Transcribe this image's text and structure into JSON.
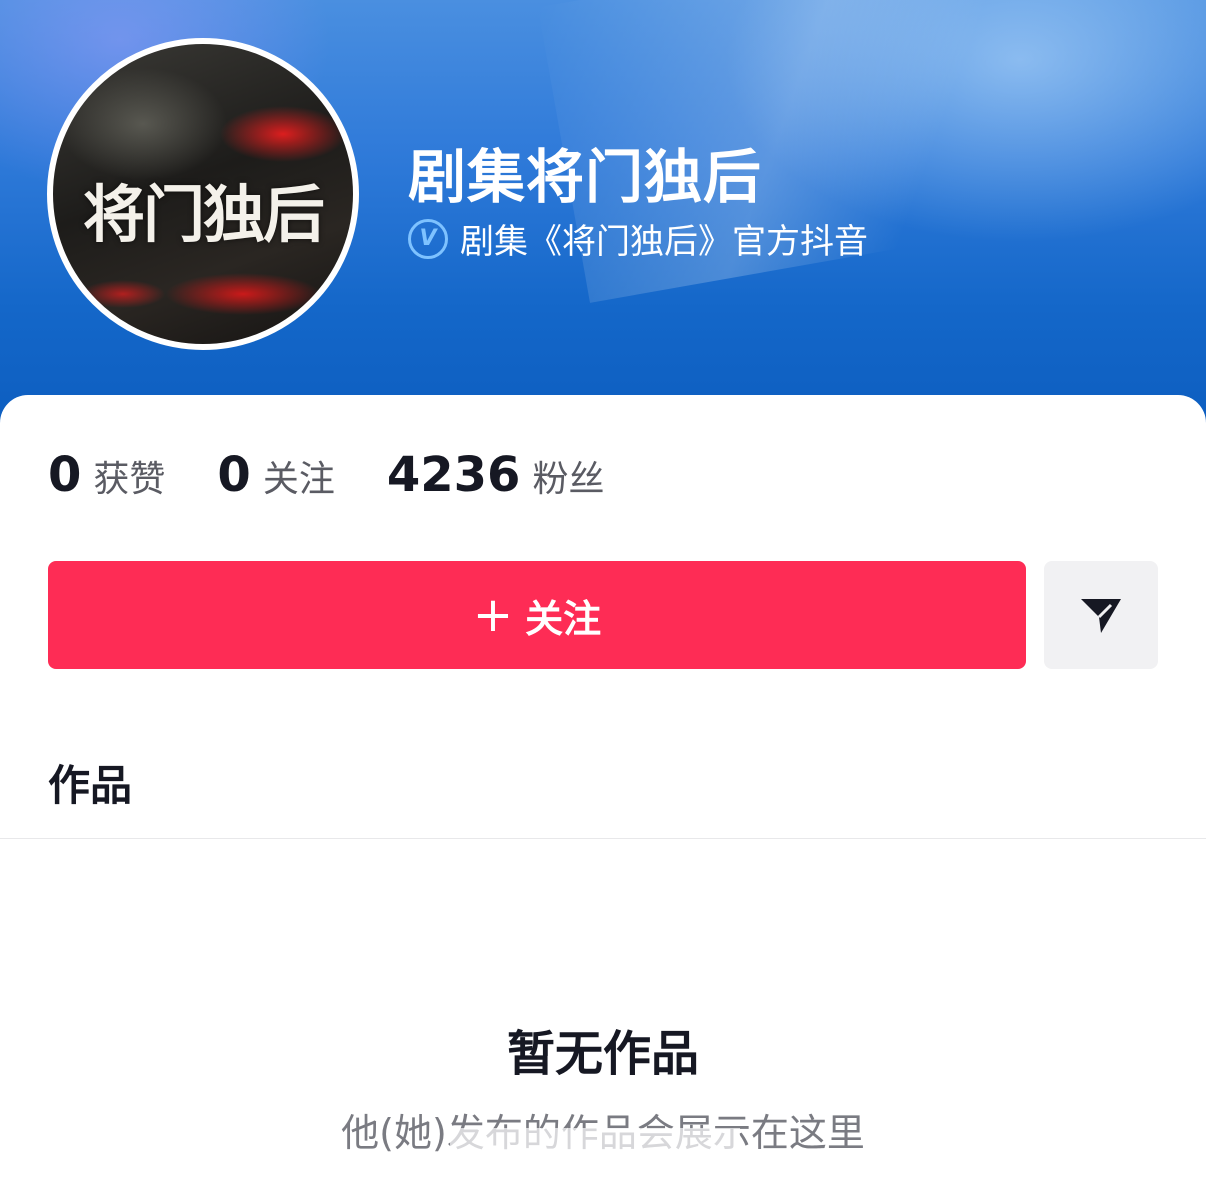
{
  "profile": {
    "name": "剧集将门独后",
    "verify_badge": "V",
    "verify_text": "剧集《将门独后》官方抖音",
    "avatar_text": "将门独后"
  },
  "stats": [
    {
      "value": "0",
      "label": "获赞"
    },
    {
      "value": "0",
      "label": "关注"
    },
    {
      "value": "4236",
      "label": "粉丝"
    }
  ],
  "actions": {
    "follow_icon": "+",
    "follow_label": "关注",
    "share_icon": "send-icon"
  },
  "tabs": {
    "works_label": "作品"
  },
  "empty_state": {
    "title": "暂无作品",
    "subtitle": "他(她)发布的作品会展示在这里"
  },
  "colors": {
    "accent": "#fe2c55",
    "banner": "#1467c9",
    "verify": "#7ec2ff"
  }
}
